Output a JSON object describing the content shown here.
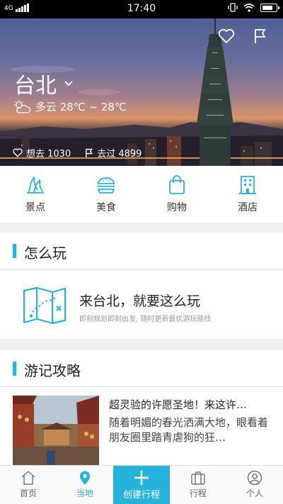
{
  "status_bar": {
    "network": "4G",
    "time": "17:40"
  },
  "hero": {
    "city": "台北",
    "weather": "多云 28℃ ~ 28℃",
    "want_to_go": "想去 1030",
    "been_to": "去过 4899"
  },
  "categories": [
    {
      "label": "景点",
      "icon": "attraction-icon"
    },
    {
      "label": "美食",
      "icon": "food-icon"
    },
    {
      "label": "购物",
      "icon": "shopping-icon"
    },
    {
      "label": "酒店",
      "icon": "hotel-icon"
    }
  ],
  "how_to_play": {
    "section_title": "怎么玩",
    "title": "来台北，就要这么玩",
    "subtitle": "即刻规划即刻出发, 随时更新最优游玩路线"
  },
  "travel_notes": {
    "section_title": "游记攻略",
    "article_title": "超灵验的许愿圣地！来这许…",
    "article_desc": "随着明媚的春光洒满大地，眼看着朋友圈里踏青虐狗的狂…"
  },
  "tabbar": {
    "home": "首页",
    "local": "当地",
    "create": "创建行程",
    "trips": "行程",
    "me": "个人"
  },
  "colors": {
    "accent": "#27b2dc"
  }
}
